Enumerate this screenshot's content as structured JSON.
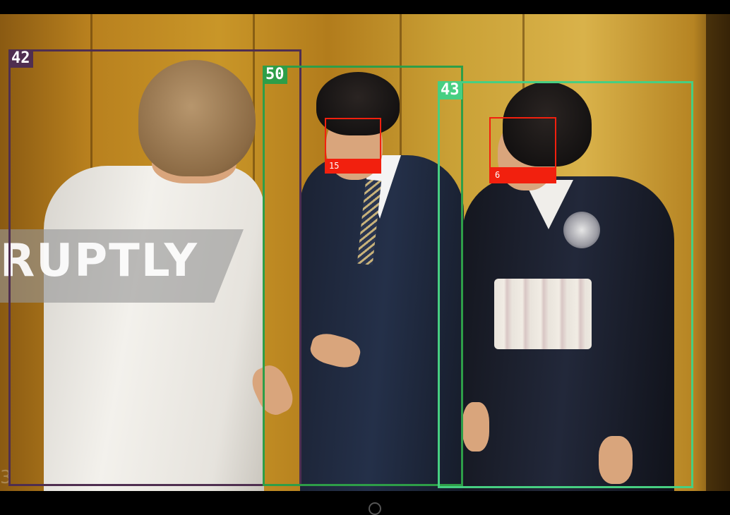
{
  "watermark": {
    "text": "RUPTLY"
  },
  "detections": {
    "person_boxes": [
      {
        "id": "42",
        "color": "#4f2e50"
      },
      {
        "id": "50",
        "color": "#2e9e48"
      },
      {
        "id": "43",
        "color": "#47cf82"
      }
    ],
    "face_boxes": [
      {
        "id": "15",
        "color": "#f2200e"
      },
      {
        "id": "6",
        "color": "#f2200e"
      }
    ]
  },
  "corner_mark": "3"
}
